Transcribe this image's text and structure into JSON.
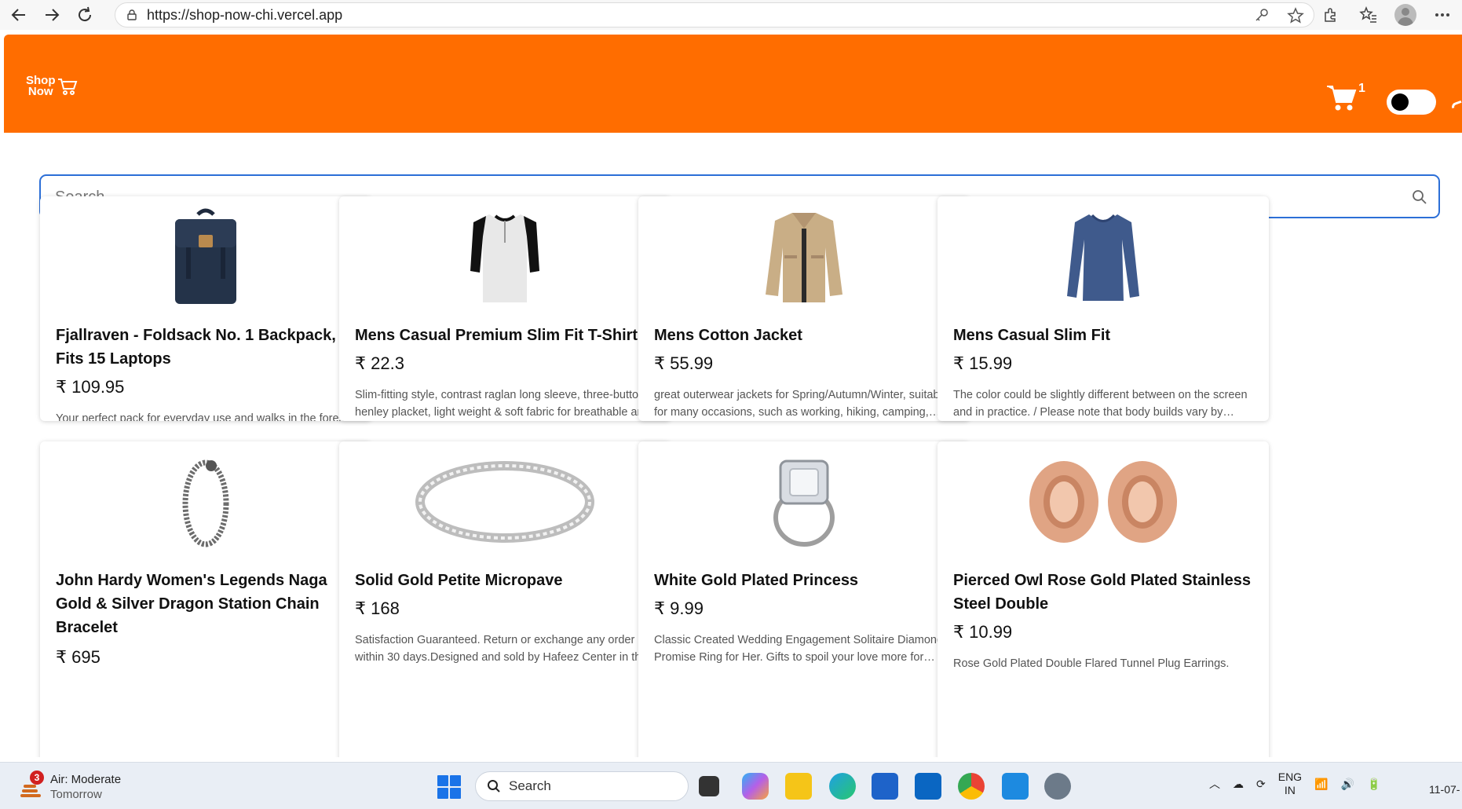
{
  "browser": {
    "url": "https://shop-now-chi.vercel.app"
  },
  "header": {
    "logo_line1": "Shop",
    "logo_line2": "Now",
    "cart_count": "1",
    "brand_color": "#ff6d00"
  },
  "search": {
    "placeholder": "Search..."
  },
  "products": [
    {
      "title": "Fjallraven - Foldsack No. 1 Backpack, Fits 15 Laptops",
      "price": "₹ 109.95",
      "description": "Your perfect pack for everyday use and walks in the forest. Stash your laptop (up to 15 inches) in the padded sleeve, your everyday",
      "image_icon": "backpack-icon"
    },
    {
      "title": "Mens Casual Premium Slim Fit T-Shirts",
      "price": "₹ 22.3",
      "description": "Slim-fitting style, contrast raglan long sleeve, three-button henley placket, light weight & soft fabric for breathable and comfortable wearing.",
      "image_icon": "tshirt-icon"
    },
    {
      "title": "Mens Cotton Jacket",
      "price": "₹ 55.99",
      "description": "great outerwear jackets for Spring/Autumn/Winter, suitable for many occasions, such as working, hiking, camping, mountain/rock climbing.",
      "image_icon": "jacket-icon"
    },
    {
      "title": "Mens Casual Slim Fit",
      "price": "₹ 15.99",
      "description": "The color could be slightly different between on the screen and in practice. / Please note that body builds vary by person.",
      "image_icon": "longsleeve-icon"
    },
    {
      "title": "John Hardy Women's Legends Naga Gold & Silver Dragon Station Chain Bracelet",
      "price": "₹ 695",
      "description": "",
      "image_icon": "bracelet-icon"
    },
    {
      "title": "Solid Gold Petite Micropave",
      "price": "₹ 168",
      "description": "Satisfaction Guaranteed. Return or exchange any order within 30 days.Designed and sold by Hafeez Center in the United States.",
      "image_icon": "band-ring-icon"
    },
    {
      "title": "White Gold Plated Princess",
      "price": "₹ 9.99",
      "description": "Classic Created Wedding Engagement Solitaire Diamond Promise Ring for Her. Gifts to spoil your love more for Engagement, Wedding.",
      "image_icon": "diamond-ring-icon"
    },
    {
      "title": "Pierced Owl Rose Gold Plated Stainless Steel Double",
      "price": "₹ 10.99",
      "description": "Rose Gold Plated Double Flared Tunnel Plug Earrings.",
      "image_icon": "earrings-icon"
    }
  ],
  "taskbar": {
    "weather_title": "Air: Moderate",
    "weather_sub": "Tomorrow",
    "weather_badge": "3",
    "search_label": "Search",
    "lang_line1": "ENG",
    "lang_line2": "IN",
    "date_partial": "11-07-"
  }
}
